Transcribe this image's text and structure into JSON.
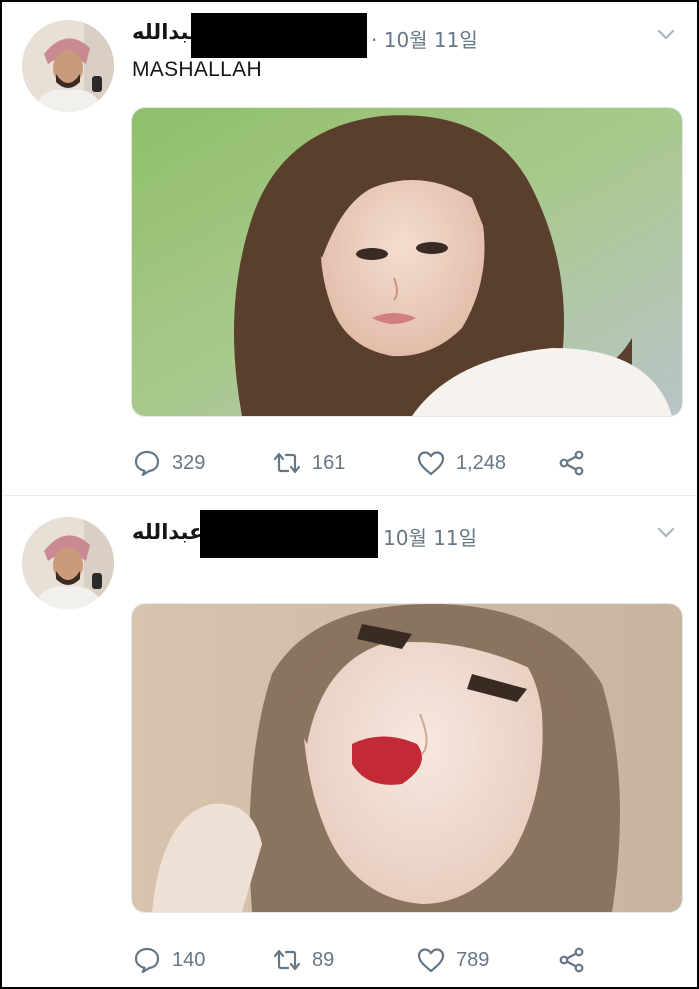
{
  "tweets": [
    {
      "author_name": "عبدالله",
      "date": "· 10월 11일",
      "text": "MASHALLAH",
      "replies": "329",
      "retweets": "161",
      "likes": "1,248"
    },
    {
      "author_name": "عبدالله",
      "date": "10월 11일",
      "text": "",
      "replies": "140",
      "retweets": "89",
      "likes": "789"
    }
  ],
  "colors": {
    "icon_gray": "#657786",
    "caret_gray": "#aab8c2",
    "redaction": "#000000"
  },
  "icons": {
    "reply": "speech-bubble-icon",
    "retweet": "retweet-arrows-icon",
    "like": "heart-icon",
    "share": "share-nodes-icon",
    "more": "chevron-down-icon"
  }
}
